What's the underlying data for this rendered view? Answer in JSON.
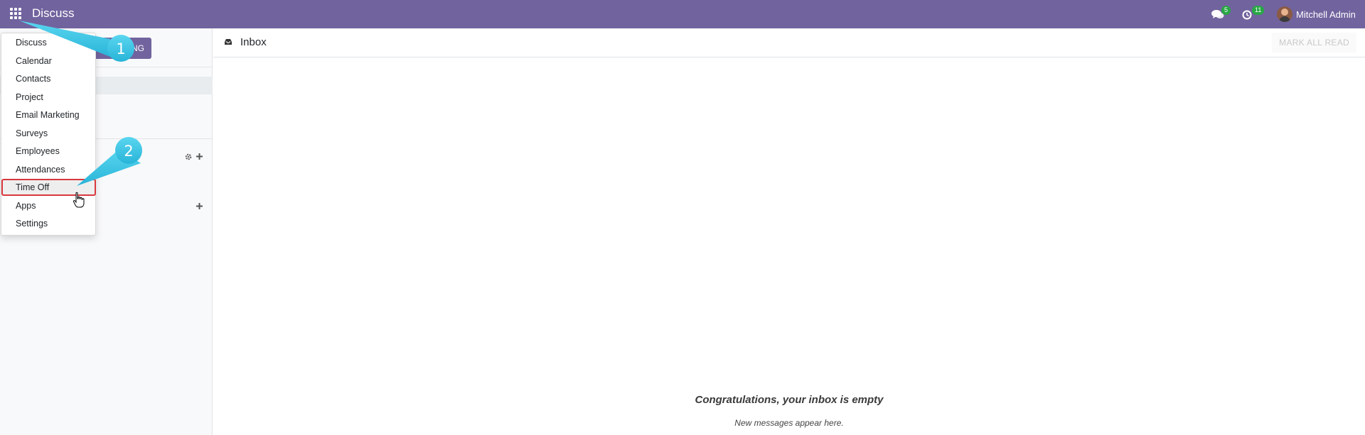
{
  "navbar": {
    "app_title": "Discuss",
    "messages_count": "5",
    "activities_count": "11",
    "user_name": "Mitchell Admin",
    "bg_color": "#71639e"
  },
  "sidebar": {
    "start_meeting_visible_label": "NG"
  },
  "header": {
    "title": "Inbox",
    "mark_all_read": "MARK ALL READ"
  },
  "empty_state": {
    "title": "Congratulations, your inbox is empty",
    "subtitle": "New messages appear here."
  },
  "apps_menu": {
    "items": [
      {
        "label": "Discuss"
      },
      {
        "label": "Calendar"
      },
      {
        "label": "Contacts"
      },
      {
        "label": "Project"
      },
      {
        "label": "Email Marketing"
      },
      {
        "label": "Surveys"
      },
      {
        "label": "Employees"
      },
      {
        "label": "Attendances"
      },
      {
        "label": "Time Off"
      },
      {
        "label": "Apps"
      },
      {
        "label": "Settings"
      }
    ],
    "highlighted": "Time Off"
  },
  "callouts": {
    "step1": "1",
    "step2": "2",
    "color": "#3ec7e6"
  },
  "icons": {
    "apps": "grid-icon",
    "messages": "chat-icon",
    "activities": "clock-icon",
    "inbox": "inbox-icon",
    "channels_settings": "gear-icon",
    "add": "plus-icon",
    "cursor": "hand-pointer-icon"
  }
}
